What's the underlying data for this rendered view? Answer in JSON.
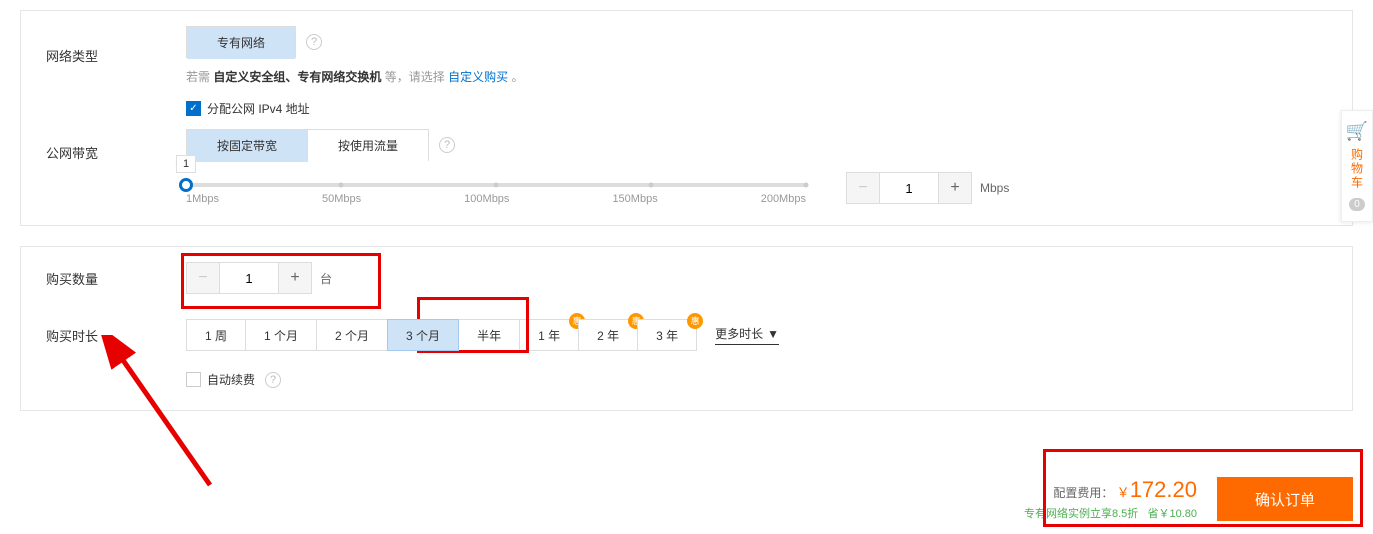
{
  "network": {
    "label": "网络类型",
    "options": {
      "vpc": "专有网络"
    },
    "hint_prefix": "若需",
    "hint_bold": "自定义安全组、专有网络交换机",
    "hint_suffix": "等，请选择",
    "hint_link": "自定义购买",
    "hint_end": "。"
  },
  "bandwidth": {
    "label": "公网带宽",
    "assign_ip": "分配公网 IPv4 地址",
    "billing": {
      "fixed": "按固定带宽",
      "traffic": "按使用流量"
    },
    "slider": {
      "value_label": "1",
      "ticks": [
        "1Mbps",
        "50Mbps",
        "100Mbps",
        "150Mbps",
        "200Mbps"
      ]
    },
    "stepper_value": "1",
    "unit": "Mbps"
  },
  "quantity": {
    "label": "购买数量",
    "value": "1",
    "unit": "台"
  },
  "duration": {
    "label": "购买时长",
    "options": [
      {
        "label": "1 周",
        "selected": false,
        "badge": false
      },
      {
        "label": "1 个月",
        "selected": false,
        "badge": false
      },
      {
        "label": "2 个月",
        "selected": false,
        "badge": false
      },
      {
        "label": "3 个月",
        "selected": true,
        "badge": false
      },
      {
        "label": "半年",
        "selected": false,
        "badge": false
      },
      {
        "label": "1 年",
        "selected": false,
        "badge": true
      },
      {
        "label": "2 年",
        "selected": false,
        "badge": true
      },
      {
        "label": "3 年",
        "selected": false,
        "badge": true
      }
    ],
    "badge_text": "惠",
    "more": "更多时长"
  },
  "autorenew": {
    "label": "自动续费"
  },
  "cart": {
    "label": "购物车",
    "count": "0"
  },
  "footer": {
    "fee_label": "配置费用：",
    "currency": "￥",
    "price": "172.20",
    "discount_text": "专有网络实例立享8.5折",
    "save_text": "省￥10.80",
    "confirm": "确认订单"
  }
}
